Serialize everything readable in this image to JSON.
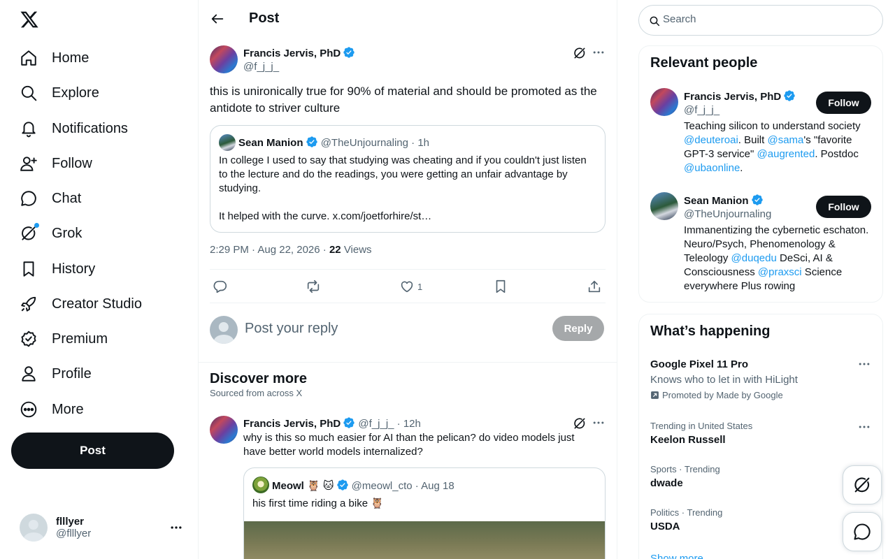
{
  "nav": {
    "items": [
      {
        "label": "Home"
      },
      {
        "label": "Explore"
      },
      {
        "label": "Notifications"
      },
      {
        "label": "Follow"
      },
      {
        "label": "Chat"
      },
      {
        "label": "Grok"
      },
      {
        "label": "History"
      },
      {
        "label": "Creator Studio"
      },
      {
        "label": "Premium"
      },
      {
        "label": "Profile"
      },
      {
        "label": "More"
      }
    ],
    "post_label": "Post"
  },
  "account": {
    "name": "flllyer",
    "handle": "@flllyer"
  },
  "header": {
    "title": "Post"
  },
  "post": {
    "author": "Francis Jervis, PhD",
    "handle": "@f_j_j_",
    "text": "this is unironically true for 90% of material and should be promoted as the antidote to striver culture",
    "quote": {
      "author": "Sean Manion",
      "handle": "@TheUnjournaling",
      "time": "1h",
      "text": "In college I used to say that studying was cheating and if you couldn't just listen to the lecture and do the readings, you were getting an unfair advantage by studying.\n\nIt helped with the curve. x.com/joetforhire/st…"
    },
    "timestamp": "2:29 PM · Aug 22, 2026 ·",
    "views_count": "22",
    "views_label": "Views",
    "likes": "1"
  },
  "reply": {
    "placeholder": "Post your reply",
    "button": "Reply"
  },
  "discover": {
    "title": "Discover more",
    "subtitle": "Sourced from across X",
    "post": {
      "author": "Francis Jervis, PhD",
      "handle": "@f_j_j_",
      "time": "12h",
      "text": "why is this so much easier for AI than the pelican? do video models just have better world models internalized?",
      "quote": {
        "author": "Meowl",
        "emoji": "🦉 🐱",
        "handle": "@meowl_cto",
        "time": "Aug 18",
        "text": "his first time riding a bike",
        "text_emoji": "🦉"
      }
    }
  },
  "search": {
    "placeholder": "Search"
  },
  "relevant": {
    "title": "Relevant people",
    "people": [
      {
        "name": "Francis Jervis, PhD",
        "handle": "@f_j_j_",
        "follow": "Follow",
        "bio": [
          {
            "t": "Teaching silicon to understand society "
          },
          {
            "t": "@deuteroai",
            "link": true
          },
          {
            "t": ". Built "
          },
          {
            "t": "@sama",
            "link": true
          },
          {
            "t": "'s \"favorite GPT-3 service\" "
          },
          {
            "t": "@augrented",
            "link": true
          },
          {
            "t": ". Postdoc "
          },
          {
            "t": "@ubaonline",
            "link": true
          },
          {
            "t": "."
          }
        ]
      },
      {
        "name": "Sean Manion",
        "handle": "@TheUnjournaling",
        "follow": "Follow",
        "bio": [
          {
            "t": "Immanentizing the cybernetic eschaton. Neuro/Psych, Phenomenology & Teleology "
          },
          {
            "t": "@duqedu",
            "link": true
          },
          {
            "t": " DeSci, AI & Consciousness "
          },
          {
            "t": "@praxsci",
            "link": true
          },
          {
            "t": " Science everywhere Plus rowing"
          }
        ]
      }
    ]
  },
  "trends": {
    "title": "What’s happening",
    "promo": {
      "name": "Google Pixel 11 Pro",
      "desc": "Knows who to let in with HiLight",
      "promoted": "Promoted by Made by Google"
    },
    "items": [
      {
        "context": "Trending in United States",
        "name": "Keelon Russell"
      },
      {
        "context": "Sports · Trending",
        "name": "dwade"
      },
      {
        "context": "Politics · Trending",
        "name": "USDA"
      }
    ],
    "show_more": "Show more"
  },
  "colors": {
    "accent": "#1d9bf0",
    "text": "#0f1419",
    "muted": "#536471",
    "border": "#eff3f4"
  }
}
